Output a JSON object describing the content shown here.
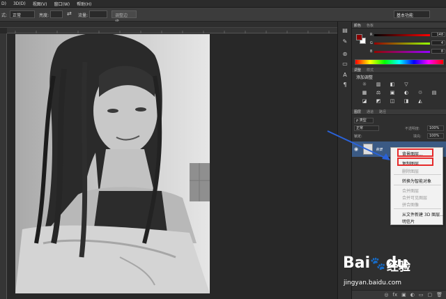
{
  "menubar": {
    "items": [
      "D)",
      "3D(D)",
      "视图(V)",
      "窗口(W)",
      "帮助(H)"
    ]
  },
  "options": {
    "mode_label": "式:",
    "mode_value": "正常",
    "opacity_label": "亮度:",
    "flow_label": "流量:",
    "refine_button": "调整边缘...",
    "workspace_value": "基本功能"
  },
  "panels": {
    "color_tabs": [
      "颜色",
      "色板"
    ],
    "color": {
      "fg": "#8b0000",
      "bg": "#ffffff",
      "r_label": "R",
      "g_label": "G",
      "b_label": "B",
      "r": "148",
      "g": "4",
      "b": "8"
    },
    "adjust_tabs": [
      "调整",
      "样式"
    ],
    "adjust_title": "添加调整",
    "adjust_icons": [
      "☼",
      "▥",
      "◧",
      "▽",
      "",
      "",
      "▦",
      "⚖",
      "▣",
      "◐",
      "♲",
      "▤",
      "◪",
      "◩",
      "◫",
      "◨",
      "◭",
      ""
    ],
    "layers_tabs": [
      "图层",
      "通道",
      "路径"
    ],
    "kind_label": "ρ 类型",
    "blend_value": "正常",
    "opacity_label": "不透明度:",
    "opacity_value": "100%",
    "lock_label": "锁定:",
    "fill_label": "填充:",
    "fill_value": "100%",
    "layer_name": "背景",
    "bottom_icons": [
      "◎",
      "fx",
      "▣",
      "◐",
      "▭",
      "▢",
      "🗑"
    ]
  },
  "context_menu": {
    "items": [
      {
        "label": "背景图层...",
        "disabled": false
      },
      {
        "label": "复制图层...",
        "disabled": false
      },
      {
        "label": "删除图层",
        "disabled": true
      },
      {
        "label": "转换为智能对象",
        "disabled": false
      },
      {
        "label": "合并图层",
        "disabled": true
      },
      {
        "label": "合并可见图层",
        "disabled": true
      },
      {
        "label": "拼合图像",
        "disabled": true
      },
      {
        "label": "从文件新建 3D 图层...",
        "disabled": false
      },
      {
        "label": "明信片",
        "disabled": false
      }
    ]
  },
  "watermark": {
    "logo": "Bai",
    "logo_du": "du",
    "brand_cn": "经验",
    "url": "jingyan.baidu.com"
  },
  "colors": {
    "highlight_red": "#e62a2a",
    "arrow_blue": "#2a62d8",
    "layer_selected": "#3b5a84"
  }
}
